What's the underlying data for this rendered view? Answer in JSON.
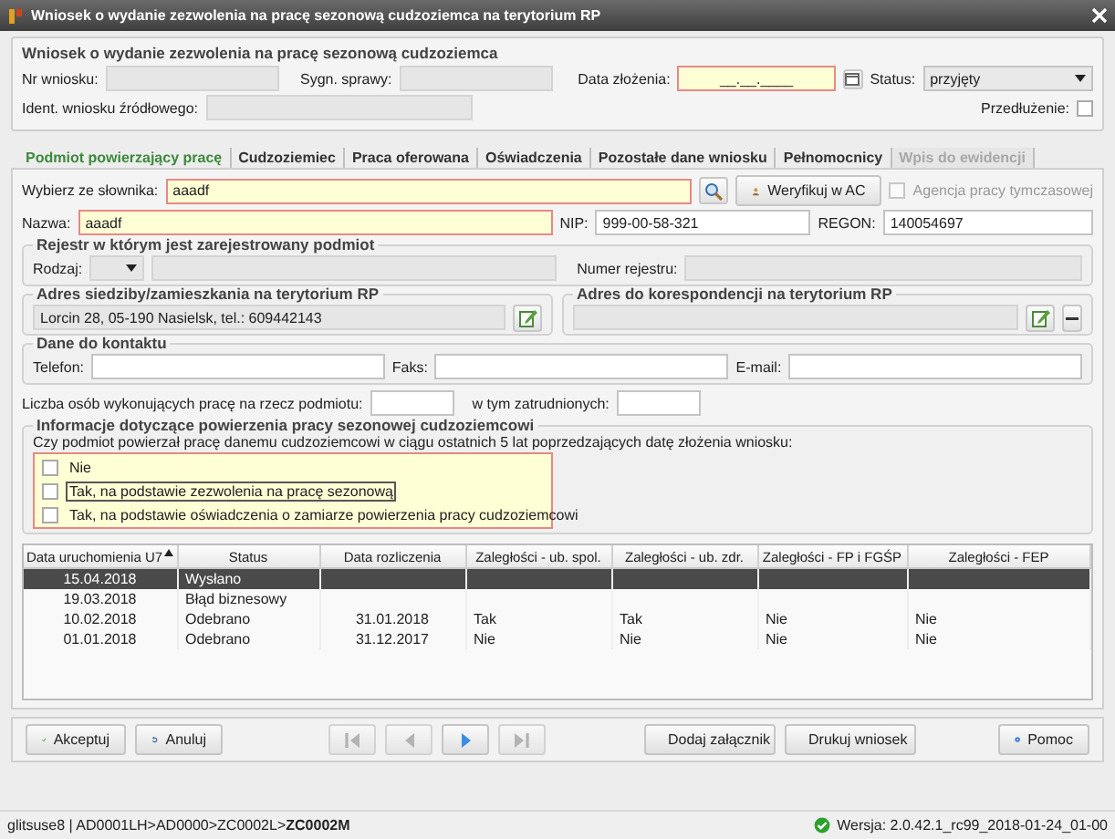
{
  "window": {
    "title": "Wniosek o wydanie zezwolenia na pracę sezonową cudzoziemca na terytorium RP"
  },
  "application": {
    "title": "Wniosek o wydanie zezwolenia na pracę sezonową cudzoziemca",
    "nr_wniosku": "Nr wniosku:",
    "sygn_sprawy": "Sygn. sprawy:",
    "data_zlozenia": {
      "label": "Data złożenia:",
      "value": "__.__.____"
    },
    "status": {
      "label": "Status:",
      "value": "przyjęty"
    },
    "ident": "Ident. wniosku źródłowego:",
    "przedluzenie": {
      "label": "Przedłużenie:",
      "checked": false
    }
  },
  "tabs": [
    {
      "label": "Podmiot powierzający pracę",
      "selected": true,
      "disabled": false
    },
    {
      "label": "Cudzoziemiec",
      "selected": false,
      "disabled": false
    },
    {
      "label": "Praca oferowana",
      "selected": false,
      "disabled": false
    },
    {
      "label": "Oświadczenia",
      "selected": false,
      "disabled": false
    },
    {
      "label": "Pozostałe dane wniosku",
      "selected": false,
      "disabled": false
    },
    {
      "label": "Pełnomocnicy",
      "selected": false,
      "disabled": false
    },
    {
      "label": "Wpis do ewidencji",
      "selected": false,
      "disabled": true
    }
  ],
  "entity": {
    "dictionary": {
      "label": "Wybierz ze słownika:",
      "value": "aaadf"
    },
    "verify_button": "Weryfikuj w AC",
    "agency": {
      "label": "Agencja pracy tymczasowej",
      "checked": false,
      "disabled": true
    },
    "nazwa": {
      "label": "Nazwa:",
      "value": "aaadf"
    },
    "nip": {
      "label": "NIP:",
      "value": "999-00-58-321"
    },
    "regon": {
      "label": "REGON:",
      "value": "140054697"
    }
  },
  "registry": {
    "title": "Rejestr w którym jest zarejestrowany podmiot",
    "rodzaj": "Rodzaj:",
    "numer": "Numer rejestru:"
  },
  "address": {
    "title": "Adres siedziby/zamieszkania na terytorium RP",
    "value": "Lorcin 28, 05-190 Nasielsk, tel.: 609442143"
  },
  "correspondence": {
    "title": "Adres do korespondencji na terytorium RP"
  },
  "contact": {
    "title": "Dane do kontaktu",
    "fields": [
      "Telefon:",
      "Faks:",
      "E-mail:"
    ]
  },
  "employees": {
    "label": "Liczba osób wykonujących pracę na rzecz podmiotu:",
    "employed_label": "w tym zatrudnionych:"
  },
  "seasonal": {
    "title": "Informacje dotyczące powierzenia pracy sezonowej cudzoziemcowi",
    "question": "Czy podmiot powierzał pracę danemu cudzoziemcowi w ciągu ostatnich 5 lat poprzedzających datę złożenia wniosku:",
    "options": [
      {
        "label": "Nie",
        "checked": false,
        "focused": false
      },
      {
        "label": "Tak, na podstawie zezwolenia na pracę sezonową",
        "checked": false,
        "focused": true
      },
      {
        "label": "Tak, na podstawie oświadczenia o zamiarze powierzenia pracy cudzoziemcowi",
        "checked": false,
        "focused": false
      }
    ]
  },
  "table": {
    "columns": [
      {
        "label": "Data uruchomienia U7",
        "sorted": true
      },
      {
        "label": "Status",
        "sorted": false
      },
      {
        "label": "Data rozliczenia",
        "sorted": false
      },
      {
        "label": "Zaległości - ub. spol.",
        "sorted": false
      },
      {
        "label": "Zaległości - ub. zdr.",
        "sorted": false
      },
      {
        "label": "Zaległości - FP i FGŚP",
        "sorted": false
      },
      {
        "label": "Zaległości - FEP",
        "sorted": false
      }
    ],
    "rows": [
      {
        "cells": [
          "15.04.2018",
          "Wysłano",
          "",
          "",
          "",
          "",
          ""
        ],
        "selected": true
      },
      {
        "cells": [
          "19.03.2018",
          "Błąd biznesowy",
          "",
          "",
          "",
          "",
          ""
        ],
        "selected": false
      },
      {
        "cells": [
          "10.02.2018",
          "Odebrano",
          "31.01.2018",
          "Tak",
          "Tak",
          "Nie",
          "Nie"
        ],
        "selected": false
      },
      {
        "cells": [
          "01.01.2018",
          "Odebrano",
          "31.12.2017",
          "Nie",
          "Nie",
          "Nie",
          "Nie"
        ],
        "selected": false
      }
    ]
  },
  "buttons": {
    "accept": "Akceptuj",
    "cancel": "Anuluj",
    "attach": "Dodaj załącznik",
    "print": "Drukuj wniosek",
    "help": "Pomoc"
  },
  "nav_buttons": [
    {
      "kind": "first",
      "disabled": true
    },
    {
      "kind": "prev",
      "disabled": true
    },
    {
      "kind": "next",
      "disabled": false
    },
    {
      "kind": "last",
      "disabled": true
    }
  ],
  "status_bar": {
    "path": "glitsuse8 | AD0001LH>AD0000>ZC0002L>**ZC0002M**",
    "version": "Wersja: 2.0.42.1_rc99_2018-01-24_01-00"
  }
}
